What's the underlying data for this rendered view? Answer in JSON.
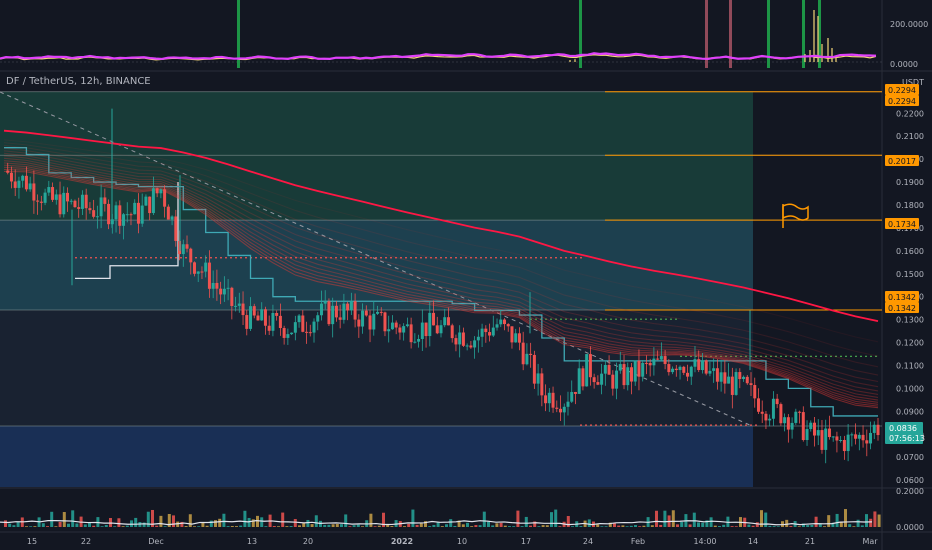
{
  "legend": {
    "symbol": "DF / TetherUS, 12h, BINANCE"
  },
  "currency": "USDT",
  "colors": {
    "background": "#131722",
    "up": "#26a69a",
    "down": "#ef5350",
    "orange": "#ff9800",
    "ribbon": "#e53935",
    "teal_line": "#3fa9b5",
    "osc_magenta": "#e040fb",
    "osc_yellow": "#f5d77a",
    "green_box": "#1e5a4a",
    "blue_box": "#1d3a6b"
  },
  "chart_data": [
    {
      "type": "line",
      "title": "",
      "panel": "oscillator",
      "y_ticks": [
        "200.0000",
        "0.0000"
      ],
      "ylim": [
        0,
        300
      ],
      "x": [
        0,
        10,
        20,
        30,
        40,
        50,
        60,
        70,
        80,
        90,
        100
      ],
      "series": [
        {
          "values": [
            20,
            25,
            18,
            22,
            20,
            35,
            30,
            40,
            20,
            25,
            35
          ]
        },
        {
          "values": [
            15,
            20,
            15,
            18,
            18,
            28,
            25,
            32,
            18,
            22,
            28
          ]
        }
      ]
    },
    {
      "type": "line",
      "title": "",
      "panel": "price",
      "y_ticks": [
        "0.2200",
        "0.2100",
        "0.2000",
        "0.1900",
        "0.1800",
        "0.1700",
        "0.1600",
        "0.1500",
        "0.1400",
        "0.1300",
        "0.1200",
        "0.1100",
        "0.1000",
        "0.0900",
        "0.0800",
        "0.0700",
        "0.0600"
      ],
      "ylim": [
        0.057,
        0.238
      ],
      "x_ticks": [
        "15",
        "22",
        "Dec",
        "13",
        "20",
        "2022",
        "10",
        "17",
        "24",
        "Feb",
        "14:00",
        "14",
        "21",
        "Mar"
      ],
      "grid": false,
      "price_tags": [
        {
          "label": "0.2294",
          "value": 0.2294
        },
        {
          "label": "0.2294",
          "value": 0.2294
        },
        {
          "label": "0.2017",
          "value": 0.2017
        },
        {
          "label": "0.1734",
          "value": 0.1734
        },
        {
          "label": "0.1342",
          "value": 0.1342
        },
        {
          "label": "0.1342",
          "value": 0.1342
        }
      ],
      "last_price": {
        "label": "0.0836",
        "countdown": "07:56:13"
      },
      "horizontal_levels": [
        0.2294,
        0.2017,
        0.1734,
        0.1342,
        0.0836
      ],
      "series": [
        {
          "values": [
            0.195,
            0.19,
            0.182,
            0.18,
            0.178,
            0.177,
            0.176,
            0.187,
            0.16,
            0.15,
            0.138,
            0.13,
            0.128,
            0.126,
            0.132,
            0.134,
            0.131,
            0.128,
            0.126,
            0.127,
            0.125,
            0.122,
            0.128,
            0.12,
            0.098,
            0.095,
            0.109,
            0.104,
            0.106,
            0.11,
            0.112,
            0.108,
            0.104,
            0.1,
            0.092,
            0.088,
            0.08,
            0.076,
            0.078,
            0.0836
          ]
        }
      ]
    },
    {
      "type": "bar",
      "title": "",
      "panel": "volume",
      "y_ticks": [
        "0.2000",
        "0.0000"
      ],
      "ylim": [
        0,
        0.25
      ]
    }
  ]
}
